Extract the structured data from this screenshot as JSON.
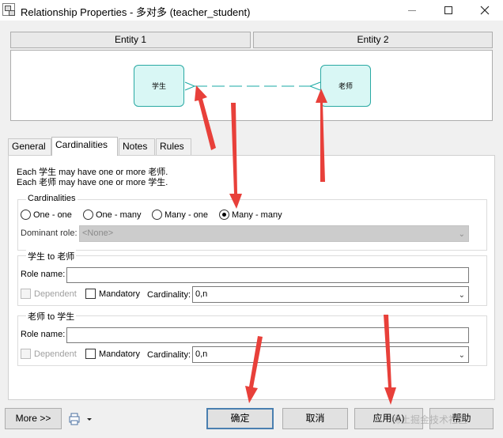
{
  "window": {
    "title": "Relationship Properties - 多对多 (teacher_student)",
    "controls": [
      "minimize",
      "maximize",
      "close"
    ]
  },
  "header": {
    "entity1_label": "Entity 1",
    "entity2_label": "Entity 2"
  },
  "diagram": {
    "entity_left": "学生",
    "entity_right": "老师"
  },
  "tabs": [
    {
      "label": "General"
    },
    {
      "label": "Cardinalities",
      "active": true
    },
    {
      "label": "Notes"
    },
    {
      "label": "Rules"
    }
  ],
  "description": {
    "line1": "Each 学生 may have one or more 老师.",
    "line2": "Each 老师 may have one or more 学生."
  },
  "cardinalities": {
    "legend": "Cardinalities",
    "options": [
      {
        "label": "One - one",
        "checked": false
      },
      {
        "label": "One - many",
        "checked": false
      },
      {
        "label": "Many - one",
        "checked": false
      },
      {
        "label": "Many - many",
        "checked": true
      }
    ],
    "dominant_role_label": "Dominant role:",
    "dominant_role_value": "<None>"
  },
  "entity1_to_entity2": {
    "legend": "学生 to 老师",
    "role_name_label": "Role name:",
    "role_name_value": "",
    "dependent_label": "Dependent",
    "mandatory_label": "Mandatory",
    "cardinality_label": "Cardinality:",
    "cardinality_value": "0,n"
  },
  "entity2_to_entity1": {
    "legend": "老师 to 学生",
    "role_name_label": "Role name:",
    "role_name_value": "",
    "dependent_label": "Dependent",
    "mandatory_label": "Mandatory",
    "cardinality_label": "Cardinality:",
    "cardinality_value": "0,n"
  },
  "buttons": {
    "more": "More >>",
    "ok": "确定",
    "cancel": "取消",
    "apply": "应用(A)",
    "help": "帮助"
  },
  "watermark": "稀土掘金技术社区",
  "colors": {
    "entity_fill": "#d9f7f5",
    "entity_border": "#2aa9a3",
    "link_line": "#1aa9a4",
    "annotation_arrow": "#e8403a",
    "default_button_border": "#4a7fb0"
  },
  "icons": [
    "relationship-app-icon",
    "print-icon",
    "dropdown-arrow-icon"
  ]
}
